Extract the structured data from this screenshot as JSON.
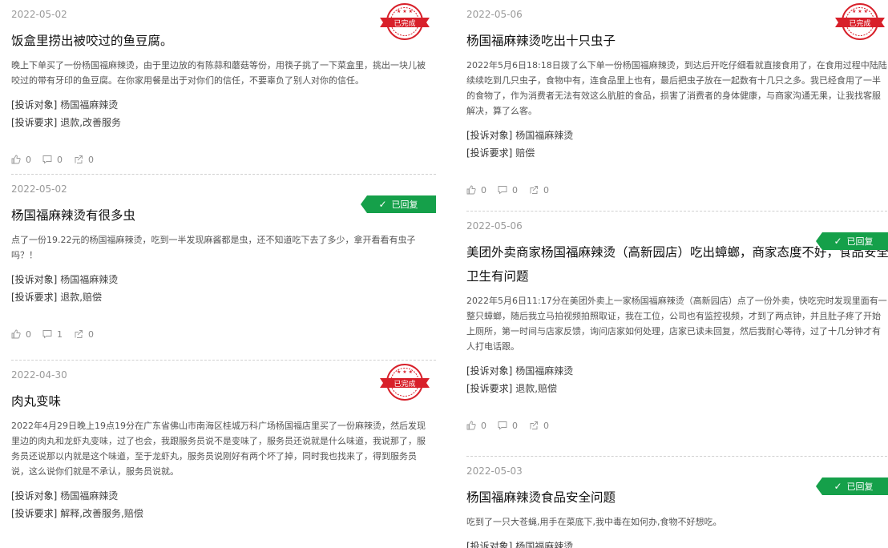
{
  "labels": {
    "target": "[投诉对象]",
    "request": "[投诉要求]"
  },
  "status": {
    "completed": "已完成",
    "replied": "已回复"
  },
  "colors": {
    "stamp_red": "#d8202a",
    "tag_green": "#15a04a"
  },
  "icons": [
    "thumb-up-icon",
    "comment-icon",
    "share-icon",
    "check-icon"
  ],
  "left": [
    {
      "date": "2022-05-02",
      "title": "饭盒里捞出被咬过的鱼豆腐。",
      "content": "晚上下单买了一份杨国福麻辣烫，由于里边放的有陈蒜和蘑菇等份，用筷子挑了一下菜盒里，挑出一块儿被咬过的带有牙印的鱼豆腐。在你家用餐是出于对你们的信任，不要辜负了别人对你的信任。",
      "target": "杨国福麻辣烫",
      "request": "退款,改善服务",
      "likes": "0",
      "comments": "0",
      "shares": "0",
      "status": "completed"
    },
    {
      "date": "2022-05-02",
      "title": "杨国福麻辣烫有很多虫",
      "content": "点了一份19.22元的杨国福麻辣烫，吃到一半发现麻酱都是虫，还不知道吃下去了多少，拿开看看有虫子吗？！",
      "target": "杨国福麻辣烫",
      "request": "退款,赔偿",
      "likes": "0",
      "comments": "1",
      "shares": "0",
      "status": "replied"
    },
    {
      "date": "2022-04-30",
      "title": "肉丸变味",
      "content": "2022年4月29日晚上19点19分在广东省佛山市南海区桂城万科广场杨国福店里买了一份麻辣烫，然后发现里边的肉丸和龙虾丸变味，过了也会，我跟服务员说不是变味了，服务员还说就是什么味道，我说那了，服务员还说那以内就是这个味道，至于龙虾丸，服务员说刚好有两个坏了掉，同时我也找来了，得到服务员说，这么说你们就是不承认，服务员说就。",
      "target": "杨国福麻辣烫",
      "request": "解释,改善服务,赔偿",
      "likes": "",
      "comments": "",
      "shares": "",
      "status": "completed"
    }
  ],
  "right": [
    {
      "date": "2022-05-06",
      "title": "杨国福麻辣烫吃出十只虫子",
      "content": "2022年5月6日18:18日拨了么下单一份杨国福麻辣烫，到达后开吃仔细看就直接食用了，在食用过程中陆陆续续吃到几只虫子，食物中有，连食品里上也有，最后把虫子放在一起数有十几只之多。我已经食用了一半的食物了，作为消费者无法有效这么肮脏的食品，损害了消费者的身体健康，与商家沟通无果，让我找客服解决，算了么客。",
      "target": "杨国福麻辣烫",
      "request": "赔偿",
      "likes": "0",
      "comments": "0",
      "shares": "0",
      "status": "completed"
    },
    {
      "date": "2022-05-06",
      "title": "美团外卖商家杨国福麻辣烫（高新园店）吃出蟑螂，商家态度不好，食品安全卫生有问题",
      "content": "2022年5月6日11:17分在美团外卖上一家杨国福麻辣烫（高新园店）点了一份外卖，快吃完时发现里面有一整只蟑螂，随后我立马拍视频拍照取证，我在工位，公司也有监控视频，才到了两点钟，并且肚子疼了开始上厕所，第一时间与店家反馈，询问店家如何处理，店家已读未回复，然后我耐心等待，过了十几分钟才有人打电话跟。",
      "target": "杨国福麻辣烫",
      "request": "退款,赔偿",
      "likes": "0",
      "comments": "0",
      "shares": "0",
      "status": "replied"
    },
    {
      "date": "2022-05-03",
      "title": "杨国福麻辣烫食品安全问题",
      "content": "吃到了一只大苍蝇,用手在菜底下,我中毒在如何办,食物不好想吃。",
      "target": "杨国福麻辣烫",
      "request": "",
      "likes": "",
      "comments": "",
      "shares": "",
      "status": "replied"
    }
  ]
}
